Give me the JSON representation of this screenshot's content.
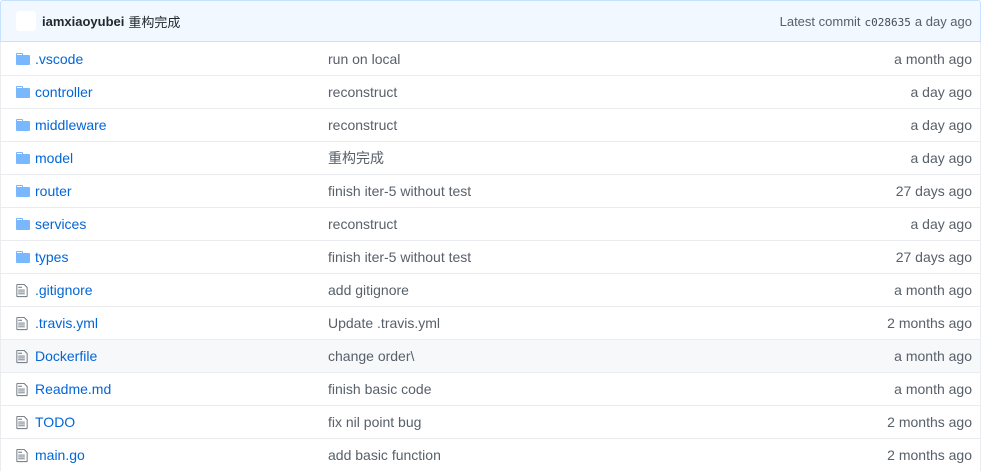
{
  "latest_commit": {
    "author": "iamxiaoyubei",
    "message": "重构完成",
    "prefix": "Latest commit",
    "sha": "c028635",
    "age": "a day ago"
  },
  "colors": {
    "link": "#0366d6",
    "folder_icon": "#79b8ff",
    "file_icon": "#6a737d",
    "commit_bar_bg": "#f1f8ff"
  },
  "files": [
    {
      "type": "dir",
      "icon": "folder-icon",
      "name": ".vscode",
      "message": "run on local",
      "age": "a month ago"
    },
    {
      "type": "dir",
      "icon": "folder-icon",
      "name": "controller",
      "message": "reconstruct",
      "age": "a day ago"
    },
    {
      "type": "dir",
      "icon": "folder-icon",
      "name": "middleware",
      "message": "reconstruct",
      "age": "a day ago"
    },
    {
      "type": "dir",
      "icon": "folder-icon",
      "name": "model",
      "message": "重构完成",
      "age": "a day ago"
    },
    {
      "type": "dir",
      "icon": "folder-icon",
      "name": "router",
      "message": "finish iter-5 without test",
      "age": "27 days ago"
    },
    {
      "type": "dir",
      "icon": "folder-icon",
      "name": "services",
      "message": "reconstruct",
      "age": "a day ago"
    },
    {
      "type": "dir",
      "icon": "folder-icon",
      "name": "types",
      "message": "finish iter-5 without test",
      "age": "27 days ago"
    },
    {
      "type": "file",
      "icon": "file-icon",
      "name": ".gitignore",
      "message": "add gitignore",
      "age": "a month ago"
    },
    {
      "type": "file",
      "icon": "file-icon",
      "name": ".travis.yml",
      "message": "Update .travis.yml",
      "age": "2 months ago"
    },
    {
      "type": "file",
      "icon": "file-icon",
      "name": "Dockerfile",
      "message": "change order\\",
      "age": "a month ago",
      "highlight": true
    },
    {
      "type": "file",
      "icon": "file-icon",
      "name": "Readme.md",
      "message": "finish basic code",
      "age": "a month ago"
    },
    {
      "type": "file",
      "icon": "file-icon",
      "name": "TODO",
      "message": "fix nil point bug",
      "age": "2 months ago"
    },
    {
      "type": "file",
      "icon": "file-icon",
      "name": "main.go",
      "message": "add basic function",
      "age": "2 months ago"
    }
  ]
}
